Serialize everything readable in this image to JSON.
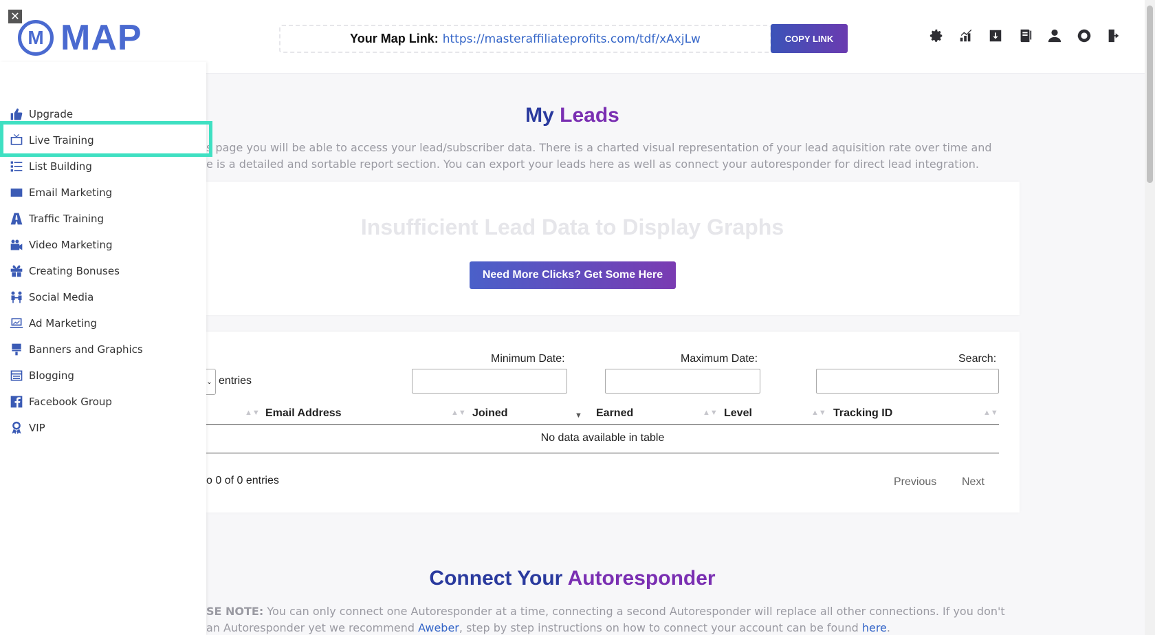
{
  "topbar": {
    "close_glyph": "✕",
    "logo_text": "MAP",
    "logo_mark": "M",
    "map_link_label": "Your Map Link:",
    "map_link_url": "https://masteraffiliateprofits.com/tdf/xAxjLw",
    "copy_button": "COPY LINK",
    "icons": [
      "gear-icon",
      "chart-icon",
      "download-icon",
      "book-icon",
      "user-icon",
      "lifebuoy-icon",
      "logout-icon"
    ]
  },
  "sidebar": {
    "items": [
      {
        "label": "Upgrade",
        "icon": "thumbs-up-icon"
      },
      {
        "label": "Live Training",
        "icon": "tv-icon"
      },
      {
        "label": "List Building",
        "icon": "list-icon"
      },
      {
        "label": "Email Marketing",
        "icon": "envelope-icon"
      },
      {
        "label": "Traffic Training",
        "icon": "road-icon"
      },
      {
        "label": "Video Marketing",
        "icon": "video-icon"
      },
      {
        "label": "Creating Bonuses",
        "icon": "gift-icon"
      },
      {
        "label": "Social Media",
        "icon": "people-icon"
      },
      {
        "label": "Ad Marketing",
        "icon": "laptop-chart-icon"
      },
      {
        "label": "Banners and Graphics",
        "icon": "paint-brush-icon"
      },
      {
        "label": "Blogging",
        "icon": "blog-icon"
      },
      {
        "label": "Facebook Group",
        "icon": "facebook-icon"
      },
      {
        "label": "VIP",
        "icon": "award-icon"
      }
    ],
    "highlighted": "Live Training"
  },
  "main": {
    "title_part1": "My",
    "title_part2": "Leads",
    "intro_line1": "s page you will be able to access your lead/subscriber data. There is a charted visual representation of your lead aquisition rate over time and",
    "intro_line2": "e is a detailed and sortable report section. You can export your leads here as well as connect your autoresponder for direct lead integration.",
    "insufficient": "Insufficient Lead Data to Display Graphs",
    "more_clicks_button": "Need More Clicks? Get Some Here",
    "table": {
      "entries_label": "entries",
      "min_date_label": "Minimum Date:",
      "max_date_label": "Maximum Date:",
      "search_label": "Search:",
      "min_date_value": "",
      "max_date_value": "",
      "search_value": "",
      "columns": [
        "Email Address",
        "Joined",
        "Earned",
        "Level",
        "Tracking ID"
      ],
      "sorted_column": "Joined",
      "empty_message": "No data available in table",
      "info": "o 0 of 0 entries",
      "previous": "Previous",
      "next": "Next"
    },
    "connect_title_part1": "Connect Your",
    "connect_title_part2": "Autoresponder",
    "note_bold": "SE NOTE:",
    "note_line1_rest": " You can only connect one Autoresponder at a time, connecting a second Autoresponder will replace all other connections. If you don't",
    "note_line2_a": "an Autoresponder yet we recommend ",
    "note_link1": "Aweber",
    "note_line2_b": ", step by step instructions on how to connect your account can be found ",
    "note_link2": "here",
    "note_line2_c": "."
  },
  "colors": {
    "brand_blue": "#4a6ad0",
    "title_navy": "#2a3a9e",
    "title_purple": "#7a2fb2",
    "highlight_teal": "#3fe0c2"
  }
}
